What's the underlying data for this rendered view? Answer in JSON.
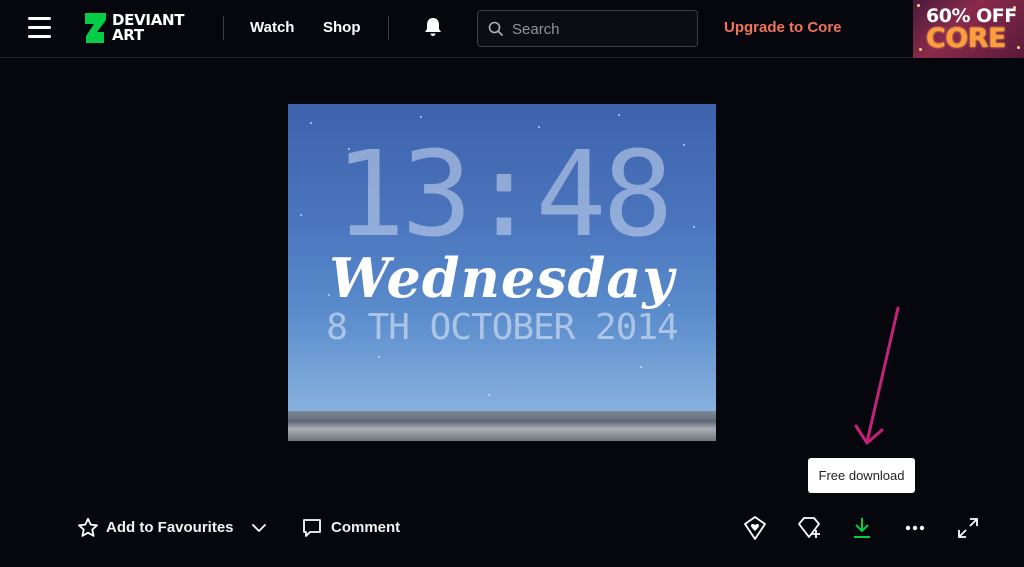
{
  "header": {
    "logo_line1": "DEVIANT",
    "logo_line2": "ART",
    "nav": {
      "watch": "Watch",
      "shop": "Shop"
    },
    "search_placeholder": "Search",
    "upgrade_label": "Upgrade to Core",
    "promo": {
      "line1": "60% OFF",
      "line2": "CORE"
    }
  },
  "artwork": {
    "time": "13:48",
    "day": "Wednesday",
    "date": "8 TH OCTOBER 2014"
  },
  "tooltip": {
    "text": "Free download"
  },
  "actions": {
    "favourite_label": "Add to Favourites",
    "comment_label": "Comment"
  },
  "colors": {
    "background": "#06070d",
    "brand_green": "#05cc47",
    "upgrade": "#f0735a",
    "download_icon": "#05cc47",
    "annotation_arrow": "#c4227a"
  },
  "icons": {
    "menu": "hamburger-icon",
    "notifications": "bell-icon",
    "search": "search-icon",
    "favourite": "star-icon",
    "more_favourite_options": "chevron-down-icon",
    "comment": "comment-bubble-icon",
    "gift_points": "heart-badge-icon",
    "give_badge": "badge-plus-icon",
    "download": "download-icon",
    "more": "more-dots-icon",
    "fullscreen": "expand-icon"
  }
}
